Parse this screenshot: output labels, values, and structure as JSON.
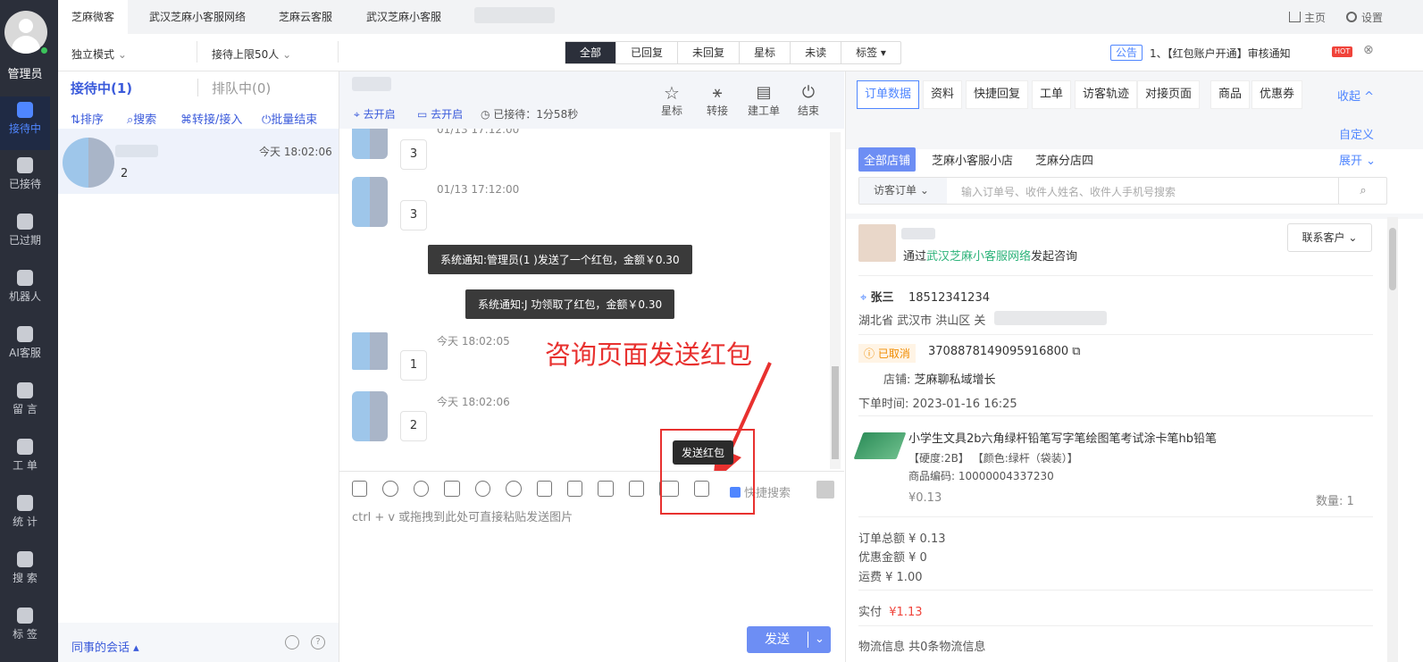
{
  "sidebar": {
    "admin_label": "管理员",
    "items": [
      {
        "label": "接待中",
        "icon": "chat-icon"
      },
      {
        "label": "已接待",
        "icon": "check-icon"
      },
      {
        "label": "已过期",
        "icon": "expired-icon"
      },
      {
        "label": "机器人",
        "icon": "robot-icon"
      },
      {
        "label": "AI客服",
        "icon": "ai-chat-icon"
      },
      {
        "label": "留 言",
        "icon": "message-icon"
      },
      {
        "label": "工 单",
        "icon": "ticket-icon"
      },
      {
        "label": "统 计",
        "icon": "stats-icon"
      },
      {
        "label": "搜 索",
        "icon": "search-icon"
      },
      {
        "label": "标 签",
        "icon": "tag-icon"
      }
    ]
  },
  "tabs": [
    "芝麻微客",
    "武汉芝麻小客服网络",
    "芝麻云客服",
    "武汉芝麻小客服"
  ],
  "header": {
    "home": "主页",
    "settings": "设置"
  },
  "toolbar": {
    "mode": "独立模式",
    "limit": "接待上限50人",
    "filters": [
      "全部",
      "已回复",
      "未回复",
      "星标",
      "未读",
      "标签"
    ],
    "announcement_badge": "公告",
    "announcement": "1、【红包账户开通】审核通知",
    "hot": "HOT"
  },
  "list": {
    "tab_active": "接待中(1)",
    "tab_queue": "排队中(0)",
    "actions": [
      "排序",
      "搜索",
      "转接/接入",
      "批量结束"
    ],
    "session": {
      "time": "今天 18:02:06",
      "count": "2"
    },
    "footer": "同事的会话"
  },
  "chat": {
    "header_items": [
      "去开启",
      "去开启",
      "已接待：1分58秒"
    ],
    "actions": [
      "星标",
      "转接",
      "建工单",
      "结束"
    ],
    "messages": [
      {
        "time": "01/13 17:12:00",
        "text": "3"
      },
      {
        "time": "01/13 17:12:00",
        "text": "3"
      },
      {
        "time": "今天 18:02:05",
        "text": "1"
      },
      {
        "time": "今天 18:02:06",
        "text": "2"
      }
    ],
    "notice1": "系统通知:管理员(1           )发送了一个红包，金额￥0.30",
    "notice2": "系统通知:J      功领取了红包，金额￥0.30",
    "annotation": "咨询页面发送红包",
    "tooltip": "发送红包",
    "quick_search": "快捷搜索",
    "input_placeholder": "ctrl + v 或拖拽到此处可直接粘贴发送图片",
    "send": "发送"
  },
  "right": {
    "tabs": [
      "订单数据",
      "资料",
      "快捷回复",
      "工单",
      "访客轨迹",
      "对接页面",
      "商品",
      "优惠券"
    ],
    "collapse": "收起",
    "customize": "自定义",
    "stores": [
      "全部店铺",
      "芝麻小客服小店",
      "芝麻分店四"
    ],
    "expand": "展开",
    "order_type": "访客订单",
    "search_placeholder": "输入订单号、收件人姓名、收件人手机号搜索",
    "contact": "联系客户",
    "via_prefix": "通过",
    "via_store": "武汉芝麻小客服网络",
    "via_suffix": "发起咨询",
    "name": "张三",
    "phone": "18512341234",
    "address": "湖北省 武汉市 洪山区 关",
    "status": "已取消",
    "order_no": "3708878149095916800",
    "store_label": "店铺:",
    "store_name": "芝麻聊私域增长",
    "order_time": "下单时间:  2023-01-16 16:25",
    "product": {
      "title": "小学生文具2b六角绿杆铅笔写字笔绘图笔考试涂卡笔hb铅笔",
      "spec": "【硬度:2B】 【颜色:绿杆（袋装）】",
      "code": "商品编码: 10000004337230",
      "price": "¥0.13",
      "qty": "数量: 1"
    },
    "total": "订单总额 ¥ 0.13",
    "discount": "优惠金额 ¥ 0",
    "shipping": "运费      ¥ 1.00",
    "paid_label": "实付",
    "paid": "¥1.13",
    "logistics": "物流信息  共0条物流信息"
  }
}
